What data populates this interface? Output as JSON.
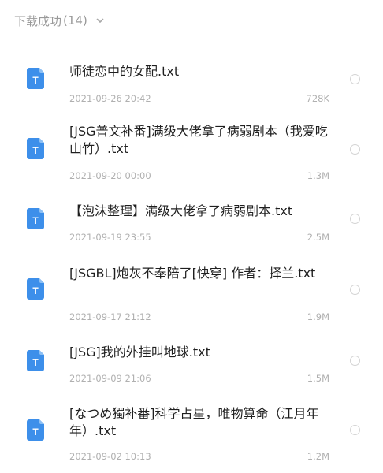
{
  "header": {
    "title": "下载成功",
    "count": "(14)",
    "chevron_icon": "chevron-down-icon"
  },
  "colors": {
    "file_icon_blue": "#3d8fea",
    "muted_text": "#b0b0b0",
    "header_text": "#9a9a9a"
  },
  "files": [
    {
      "name": "师徒恋中的女配.txt",
      "date": "2021-09-26 20:42",
      "size": "728K",
      "icon": "txt-file-icon"
    },
    {
      "name": "[JSG普文补番]满级大佬拿了病弱剧本（我爱吃山竹）.txt",
      "date": "2021-09-20 00:00",
      "size": "1.3M",
      "icon": "txt-file-icon"
    },
    {
      "name": "【泡沫整理】满级大佬拿了病弱剧本.txt",
      "date": "2021-09-19 23:55",
      "size": "2.5M",
      "icon": "txt-file-icon"
    },
    {
      "name": "[JSGBL]炮灰不奉陪了[快穿] 作者：择兰.txt",
      "date": "2021-09-17 21:12",
      "size": "1.9M",
      "icon": "txt-file-icon"
    },
    {
      "name": "[JSG]我的外挂叫地球.txt",
      "date": "2021-09-09 21:06",
      "size": "1.5M",
      "icon": "txt-file-icon"
    },
    {
      "name": "[なつめ獨补番]科学占星，唯物算命（江月年年）.txt",
      "date": "2021-09-02 10:13",
      "size": "1.2M",
      "icon": "txt-file-icon"
    }
  ]
}
